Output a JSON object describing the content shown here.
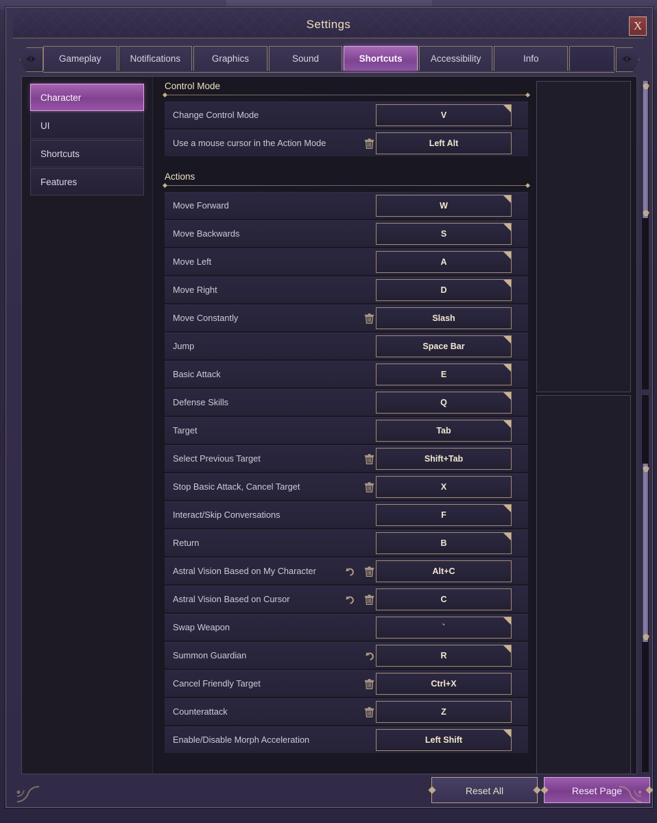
{
  "window": {
    "title": "Settings",
    "close_label": "X"
  },
  "tabs": {
    "prev_icon": "left-arrow-icon",
    "next_icon": "right-arrow-icon",
    "items": [
      {
        "label": "Gameplay",
        "active": false
      },
      {
        "label": "Notifications",
        "active": false
      },
      {
        "label": "Graphics",
        "active": false
      },
      {
        "label": "Sound",
        "active": false
      },
      {
        "label": "Shortcuts",
        "active": true
      },
      {
        "label": "Accessibility",
        "active": false
      },
      {
        "label": "Info",
        "active": false
      }
    ]
  },
  "sidebar": {
    "items": [
      {
        "label": "Character",
        "active": true
      },
      {
        "label": "UI",
        "active": false
      },
      {
        "label": "Shortcuts",
        "active": false
      },
      {
        "label": "Features",
        "active": false
      }
    ]
  },
  "sections": [
    {
      "title": "Control Mode",
      "rows": [
        {
          "label": "Change Control Mode",
          "key": "V",
          "reset": false,
          "trash": false,
          "default_marker": true
        },
        {
          "label": "Use a mouse cursor in the Action Mode",
          "key": "Left Alt",
          "reset": false,
          "trash": true,
          "default_marker": false
        }
      ]
    },
    {
      "title": "Actions",
      "rows": [
        {
          "label": "Move Forward",
          "key": "W",
          "reset": false,
          "trash": false,
          "default_marker": true
        },
        {
          "label": "Move Backwards",
          "key": "S",
          "reset": false,
          "trash": false,
          "default_marker": true
        },
        {
          "label": "Move Left",
          "key": "A",
          "reset": false,
          "trash": false,
          "default_marker": true
        },
        {
          "label": "Move Right",
          "key": "D",
          "reset": false,
          "trash": false,
          "default_marker": true
        },
        {
          "label": "Move Constantly",
          "key": "Slash",
          "reset": false,
          "trash": true,
          "default_marker": false
        },
        {
          "label": "Jump",
          "key": "Space Bar",
          "reset": false,
          "trash": false,
          "default_marker": true
        },
        {
          "label": "Basic Attack",
          "key": "E",
          "reset": false,
          "trash": false,
          "default_marker": true
        },
        {
          "label": "Defense Skills",
          "key": "Q",
          "reset": false,
          "trash": false,
          "default_marker": true
        },
        {
          "label": "Target",
          "key": "Tab",
          "reset": false,
          "trash": false,
          "default_marker": true
        },
        {
          "label": "Select Previous Target",
          "key": "Shift+Tab",
          "reset": false,
          "trash": true,
          "default_marker": false
        },
        {
          "label": "Stop Basic Attack, Cancel Target",
          "key": "X",
          "reset": false,
          "trash": true,
          "default_marker": false
        },
        {
          "label": "Interact/Skip Conversations",
          "key": "F",
          "reset": false,
          "trash": false,
          "default_marker": true
        },
        {
          "label": "Return",
          "key": "B",
          "reset": false,
          "trash": false,
          "default_marker": true
        },
        {
          "label": "Astral Vision Based on My Character",
          "key": "Alt+C",
          "reset": true,
          "trash": true,
          "default_marker": false
        },
        {
          "label": "Astral Vision Based on Cursor",
          "key": "C",
          "reset": true,
          "trash": true,
          "default_marker": false
        },
        {
          "label": "Swap Weapon",
          "key": "`",
          "reset": false,
          "trash": false,
          "default_marker": true
        },
        {
          "label": "Summon Guardian",
          "key": "R",
          "reset": true,
          "trash": false,
          "default_marker": true
        },
        {
          "label": "Cancel Friendly Target",
          "key": "Ctrl+X",
          "reset": false,
          "trash": true,
          "default_marker": false
        },
        {
          "label": "Counterattack",
          "key": "Z",
          "reset": false,
          "trash": true,
          "default_marker": false
        },
        {
          "label": "Enable/Disable Morph Acceleration",
          "key": "Left Shift",
          "reset": false,
          "trash": false,
          "default_marker": true
        }
      ]
    }
  ],
  "icons": {
    "trash": "trash-icon",
    "reset": "undo-reset-icon"
  },
  "footer": {
    "reset_all": "Reset All",
    "reset_page": "Reset Page"
  },
  "colors": {
    "accent_purple": "#8c55a3",
    "gold_border": "#a08d74",
    "panel_bg": "#2b2740",
    "text_gold": "#f0ddb9"
  }
}
